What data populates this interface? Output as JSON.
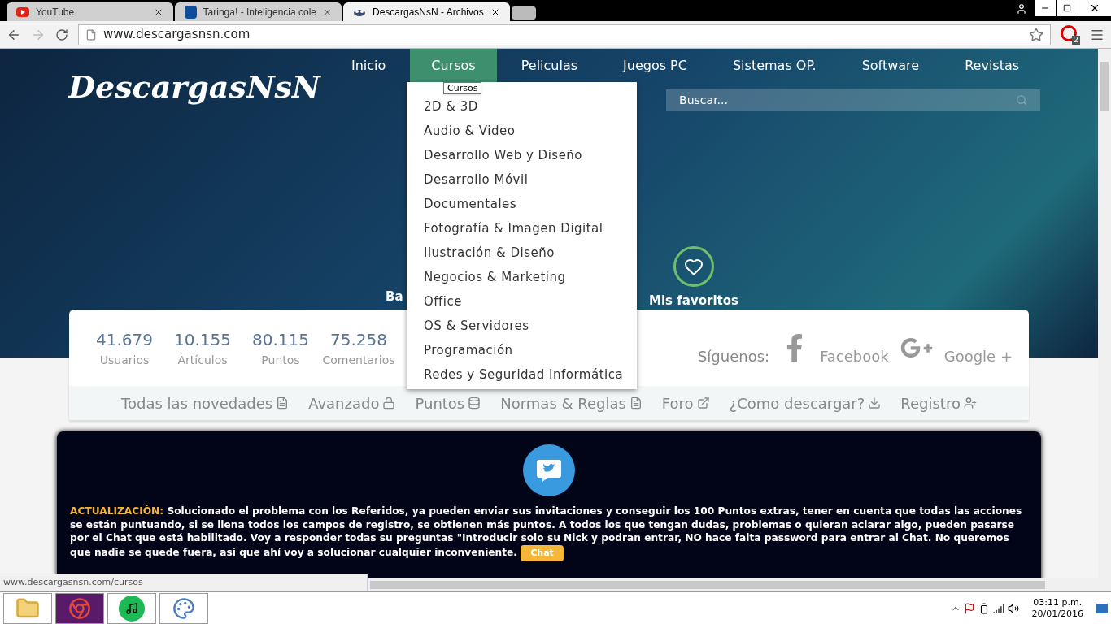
{
  "browser": {
    "tabs": [
      {
        "title": "YouTube",
        "kind": "youtube",
        "selected": false
      },
      {
        "title": "Taringa! - Inteligencia cole",
        "kind": "taringa",
        "selected": false
      },
      {
        "title": "DescargasNsN - Archivos",
        "kind": "site",
        "selected": true
      }
    ],
    "url": "www.descargasnsn.com",
    "extension_badge": "2",
    "status_url": "www.descargasnsn.com/cursos"
  },
  "site": {
    "logo": "DescargasNsN",
    "nav": [
      {
        "label": "Inicio",
        "selected": false
      },
      {
        "label": "Cursos",
        "selected": true
      },
      {
        "label": "Peliculas",
        "selected": false
      },
      {
        "label": "Juegos PC",
        "selected": false
      },
      {
        "label": "Sistemas OP.",
        "selected": false
      },
      {
        "label": "Software",
        "selected": false
      },
      {
        "label": "Revistas",
        "selected": false
      }
    ],
    "search": {
      "placeholder": "Buscar..."
    },
    "hero_links": [
      {
        "label": "Ba",
        "kind": "plain"
      },
      {
        "label": "Mis favoritos",
        "kind": "heart"
      }
    ],
    "dropdown": {
      "items": [
        "2D & 3D",
        "Audio & Video",
        "Desarrollo Web y Diseño",
        "Desarrollo Móvil",
        "Documentales",
        "Fotografía & Imagen Digital",
        "Ilustración & Diseño",
        "Negocios & Marketing",
        "Office",
        "OS & Servidores",
        "Programación",
        "Redes y Seguridad Informática"
      ],
      "tooltip": "Cursos"
    },
    "stats": [
      {
        "value": "41.679",
        "label": "Usuarios"
      },
      {
        "value": "10.155",
        "label": "Artículos"
      },
      {
        "value": "80.115",
        "label": "Puntos"
      },
      {
        "value": "75.258",
        "label": "Comentarios"
      }
    ],
    "follow": {
      "label": "Síguenos:",
      "links": [
        {
          "label": "Facebook",
          "kind": "facebook"
        },
        {
          "label": "Google +",
          "kind": "google"
        }
      ]
    },
    "menu": [
      {
        "label": "Todas las novedades",
        "kind": "doc"
      },
      {
        "label": "Avanzado",
        "kind": "lock"
      },
      {
        "label": "Puntos",
        "kind": "coins"
      },
      {
        "label": "Normas & Reglas",
        "kind": "doc"
      },
      {
        "label": "Foro",
        "kind": "external"
      },
      {
        "label": "¿Como descargar?",
        "kind": "download"
      },
      {
        "label": "Registro",
        "kind": "adduser"
      }
    ],
    "notice": {
      "heading": "ACTUALIZACIÓN:",
      "text": "Solucionado el problema con los Referidos, ya pueden enviar sus invitaciones y conseguir los 100 Puntos extras, tener en cuenta que todas las acciones se están puntuando, si se llena todos los campos de registro, se obtienen más puntos. A todos los que tengan dudas, problemas o quieran aclarar algo, pueden pasarse por el Chat que está habilitado. Voy a responder todas su preguntas \"Introducir solo su Nick y podran entrar, NO hace falta password para entrar al Chat. No queremos que nadie se quede fuera, asi que ahí voy a solucionar cualquier inconveniente.",
      "button": "Chat"
    }
  },
  "taskbar": {
    "apps": [
      {
        "kind": "folder",
        "selected": false
      },
      {
        "kind": "chrome",
        "selected": true
      },
      {
        "kind": "spotify",
        "selected": false
      },
      {
        "kind": "paint",
        "selected": false
      }
    ],
    "time": "03:11 p.m.",
    "date": "20/01/2016"
  }
}
